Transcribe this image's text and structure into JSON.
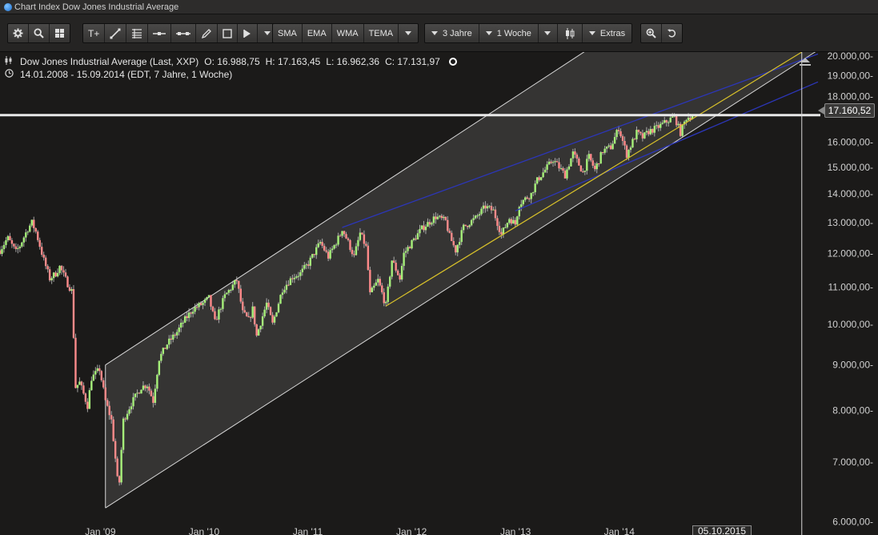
{
  "window": {
    "title": "Chart Index Dow Jones Industrial Average"
  },
  "toolbar": {
    "tools": [
      {
        "name": "settings-gear-icon"
      },
      {
        "name": "magnifier-icon"
      },
      {
        "name": "grid-layout-icon"
      }
    ],
    "drawing_tools": [
      {
        "name": "text-tool-icon",
        "label": "T+"
      },
      {
        "name": "line-tool-icon"
      },
      {
        "name": "fibonacci-tool-icon"
      },
      {
        "name": "horizontal-line-icon"
      },
      {
        "name": "ray-tool-icon"
      },
      {
        "name": "pencil-icon"
      },
      {
        "name": "rectangle-icon"
      },
      {
        "name": "cursor-icon"
      }
    ],
    "indicators": [
      "SMA",
      "EMA",
      "WMA",
      "TEMA"
    ],
    "period_label": "3 Jahre",
    "interval_label": "1 Woche",
    "chart_type_icon": "candlestick-icon",
    "extras_label": "Extras"
  },
  "info": {
    "name": "Dow Jones Industrial Average (Last, XXP)",
    "open": "O: 16.988,75",
    "high": "H: 17.163,45",
    "low": "L: 16.962,36",
    "close": "C: 17.131,97",
    "range": "14.01.2008 - 15.09.2014 (EDT, 7 Jahre, 1 Woche)"
  },
  "price_tag": "17.160,52",
  "date_tag": "05.10.2015",
  "colors": {
    "up": "#a6f07a",
    "down": "#ff8a8a",
    "wick": "#d0d0d0",
    "channel_fill": "#3a3938",
    "channel_line": "#d8d8d8",
    "blue_channel": "#2c36b8",
    "yellow_line": "#d8c12a",
    "price_line": "#e9e9e9"
  },
  "chart_data": {
    "type": "candlestick",
    "title": "Chart Index Dow Jones Industrial Average",
    "y_scale": "log",
    "ylim": [
      5800,
      20200
    ],
    "y_ticks": [
      {
        "v": 6000,
        "label": "6.000,00-"
      },
      {
        "v": 7000,
        "label": "7.000,00-"
      },
      {
        "v": 8000,
        "label": "8.000,00-"
      },
      {
        "v": 9000,
        "label": "9.000,00-"
      },
      {
        "v": 10000,
        "label": "10.000,00-"
      },
      {
        "v": 11000,
        "label": "11.000,00-"
      },
      {
        "v": 12000,
        "label": "12.000,00-"
      },
      {
        "v": 13000,
        "label": "13.000,00-"
      },
      {
        "v": 14000,
        "label": "14.000,00-"
      },
      {
        "v": 15000,
        "label": "15.000,00-"
      },
      {
        "v": 16000,
        "label": "16.000,00-"
      },
      {
        "v": 18000,
        "label": "18.000,00-"
      },
      {
        "v": 19000,
        "label": "19.000,00-"
      },
      {
        "v": 20000,
        "label": "20.000,00-"
      }
    ],
    "x_range": [
      "2008-01-14",
      "2015-12-01"
    ],
    "x_ticks": [
      {
        "t": "2009-01-01",
        "label": "Jan '09"
      },
      {
        "t": "2010-01-01",
        "label": "Jan '10"
      },
      {
        "t": "2011-01-01",
        "label": "Jan '11"
      },
      {
        "t": "2012-01-01",
        "label": "Jan '12"
      },
      {
        "t": "2013-01-01",
        "label": "Jan '13"
      },
      {
        "t": "2014-01-01",
        "label": "Jan '14"
      }
    ],
    "close_anchors": [
      [
        "2008-01-14",
        12100
      ],
      [
        "2008-02-10",
        12500
      ],
      [
        "2008-03-10",
        12050
      ],
      [
        "2008-03-24",
        12250
      ],
      [
        "2008-04-21",
        12800
      ],
      [
        "2008-05-05",
        13000
      ],
      [
        "2008-05-19",
        12700
      ],
      [
        "2008-06-16",
        11800
      ],
      [
        "2008-07-07",
        11250
      ],
      [
        "2008-07-28",
        11400
      ],
      [
        "2008-08-11",
        11600
      ],
      [
        "2008-09-08",
        11100
      ],
      [
        "2008-09-22",
        10900
      ],
      [
        "2008-10-06",
        8500
      ],
      [
        "2008-10-20",
        8600
      ],
      [
        "2008-11-17",
        8100
      ],
      [
        "2008-12-01",
        8700
      ],
      [
        "2008-12-29",
        8900
      ],
      [
        "2009-01-19",
        8200
      ],
      [
        "2009-02-09",
        7800
      ],
      [
        "2009-03-02",
        6700
      ],
      [
        "2009-03-09",
        6650
      ],
      [
        "2009-03-23",
        7800
      ],
      [
        "2009-04-20",
        8150
      ],
      [
        "2009-05-25",
        8500
      ],
      [
        "2009-06-15",
        8550
      ],
      [
        "2009-07-06",
        8200
      ],
      [
        "2009-07-27",
        9150
      ],
      [
        "2009-08-24",
        9500
      ],
      [
        "2009-09-28",
        9800
      ],
      [
        "2009-10-19",
        10050
      ],
      [
        "2009-11-23",
        10400
      ],
      [
        "2009-12-28",
        10550
      ],
      [
        "2010-01-18",
        10700
      ],
      [
        "2010-02-08",
        10050
      ],
      [
        "2010-03-15",
        10750
      ],
      [
        "2010-04-26",
        11200
      ],
      [
        "2010-05-17",
        10300
      ],
      [
        "2010-06-07",
        10100
      ],
      [
        "2010-06-21",
        10400
      ],
      [
        "2010-07-05",
        9700
      ],
      [
        "2010-08-09",
        10550
      ],
      [
        "2010-08-30",
        10000
      ],
      [
        "2010-10-04",
        10950
      ],
      [
        "2010-11-08",
        11300
      ],
      [
        "2010-12-06",
        11400
      ],
      [
        "2011-01-03",
        11700
      ],
      [
        "2011-02-14",
        12350
      ],
      [
        "2011-03-14",
        11900
      ],
      [
        "2011-04-25",
        12600
      ],
      [
        "2011-05-02",
        12800
      ],
      [
        "2011-06-13",
        11900
      ],
      [
        "2011-07-04",
        12650
      ],
      [
        "2011-07-25",
        12200
      ],
      [
        "2011-08-08",
        10800
      ],
      [
        "2011-09-05",
        11200
      ],
      [
        "2011-09-26",
        10650
      ],
      [
        "2011-10-03",
        10500
      ],
      [
        "2011-10-24",
        11800
      ],
      [
        "2011-11-21",
        11250
      ],
      [
        "2011-12-05",
        12000
      ],
      [
        "2012-01-02",
        12350
      ],
      [
        "2012-02-06",
        12800
      ],
      [
        "2012-03-26",
        13200
      ],
      [
        "2012-04-30",
        13050
      ],
      [
        "2012-05-14",
        12550
      ],
      [
        "2012-06-04",
        12100
      ],
      [
        "2012-07-02",
        12850
      ],
      [
        "2012-08-13",
        13150
      ],
      [
        "2012-09-17",
        13550
      ],
      [
        "2012-10-15",
        13400
      ],
      [
        "2012-11-12",
        12600
      ],
      [
        "2012-12-10",
        13150
      ],
      [
        "2012-12-31",
        12950
      ],
      [
        "2013-01-14",
        13650
      ],
      [
        "2013-02-25",
        14000
      ],
      [
        "2013-03-18",
        14500
      ],
      [
        "2013-05-13",
        15300
      ],
      [
        "2013-06-24",
        14700
      ],
      [
        "2013-07-22",
        15550
      ],
      [
        "2013-08-26",
        14800
      ],
      [
        "2013-09-16",
        15400
      ],
      [
        "2013-10-07",
        14900
      ],
      [
        "2013-11-04",
        15650
      ],
      [
        "2013-12-02",
        15800
      ],
      [
        "2013-12-30",
        16600
      ],
      [
        "2014-01-27",
        15500
      ],
      [
        "2014-03-03",
        16400
      ],
      [
        "2014-03-24",
        16200
      ],
      [
        "2014-04-14",
        16450
      ],
      [
        "2014-05-12",
        16600
      ],
      [
        "2014-07-14",
        17100
      ],
      [
        "2014-08-04",
        16400
      ],
      [
        "2014-08-25",
        17050
      ],
      [
        "2014-09-15",
        17131.97
      ]
    ],
    "last_bar": {
      "open": 16988.75,
      "high": 17163.45,
      "low": 16962.36,
      "close": 17131.97
    },
    "price_line": 17160.52,
    "future_marker": "2015-10-05",
    "overlays": {
      "gray_channel": {
        "lower": [
          [
            "2009-01-19",
            6220
          ],
          [
            "2015-12-01",
            20300
          ]
        ],
        "upper": [
          [
            "2009-01-19",
            9000
          ],
          [
            "2015-12-01",
            30000
          ]
        ]
      },
      "blue_channel": {
        "upper": [
          [
            "2011-05-02",
            12840
          ],
          [
            "2015-12-01",
            20100
          ]
        ],
        "lower": [
          [
            "2012-12-31",
            13400
          ],
          [
            "2015-12-01",
            18700
          ]
        ]
      },
      "yellow_line": [
        [
          "2011-10-03",
          10480
        ],
        [
          "2015-10-05",
          20200
        ]
      ]
    }
  }
}
